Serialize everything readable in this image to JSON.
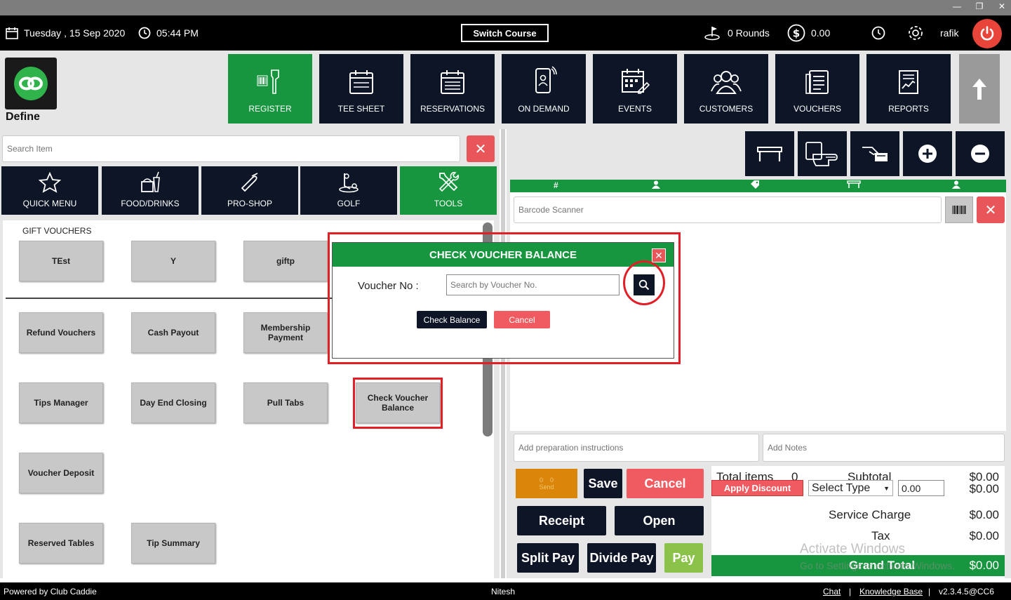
{
  "topbar": {
    "date": "Tuesday ,  15 Sep 2020",
    "time": "05:44 PM",
    "switch_course": "Switch Course",
    "rounds": "0 Rounds",
    "balance": "0.00",
    "user": "rafik"
  },
  "brand": {
    "name": "Define"
  },
  "nav": [
    {
      "label": "REGISTER",
      "icon": "barcode-scanner-icon"
    },
    {
      "label": "TEE SHEET",
      "icon": "calendar-icon"
    },
    {
      "label": "RESERVATIONS",
      "icon": "calendar-list-icon"
    },
    {
      "label": "ON DEMAND",
      "icon": "phone-person-icon"
    },
    {
      "label": "EVENTS",
      "icon": "calendar-edit-icon"
    },
    {
      "label": "CUSTOMERS",
      "icon": "users-icon"
    },
    {
      "label": "VOUCHERS",
      "icon": "voucher-list-icon"
    },
    {
      "label": "REPORTS",
      "icon": "report-icon"
    }
  ],
  "left": {
    "search_placeholder": "Search Item",
    "categories": [
      {
        "label": "QUICK MENU",
        "icon": "star-icon"
      },
      {
        "label": "FOOD/DRINKS",
        "icon": "food-drink-icon"
      },
      {
        "label": "PRO-SHOP",
        "icon": "golf-bag-icon"
      },
      {
        "label": "GOLF",
        "icon": "golf-icon"
      },
      {
        "label": "TOOLS",
        "icon": "tools-icon"
      }
    ],
    "section_label": "GIFT VOUCHERS",
    "gift_vouchers": [
      "TEst",
      "Y",
      "giftp"
    ],
    "tools": [
      "Refund Vouchers",
      "Cash Payout",
      "Membership Payment",
      "Tips Manager",
      "Day End Closing",
      "Pull Tabs",
      "Check Voucher Balance",
      "Voucher Deposit",
      "Reserved Tables",
      "Tip Summary"
    ]
  },
  "right": {
    "barcode_placeholder": "Barcode Scanner",
    "prep_placeholder": "Add preparation instructions",
    "notes_placeholder": "Add Notes",
    "send": {
      "a": "0",
      "b": "0",
      "label": "Send"
    },
    "buttons": {
      "save": "Save",
      "cancel": "Cancel",
      "receipt": "Receipt",
      "open": "Open",
      "split_pay": "Split Pay",
      "divide_pay": "Divide Pay",
      "pay": "Pay"
    },
    "totals": {
      "total_items_label": "Total items",
      "total_items": "0",
      "subtotal_label": "Subtotal",
      "subtotal": "$0.00",
      "apply_discount": "Apply Discount",
      "select_type": "Select Type",
      "discount_value": "0.00",
      "discount": "$0.00",
      "service_label": "Service Charge",
      "service": "$0.00",
      "tax_label": "Tax",
      "tax": "$0.00",
      "grand_label": "Grand Total",
      "grand": "$0.00"
    },
    "watermark": {
      "line1": "Activate Windows",
      "line2": "Go to Settings to activate Windows."
    }
  },
  "modal": {
    "title": "CHECK VOUCHER BALANCE",
    "voucher_label": "Voucher No :",
    "voucher_placeholder": "Search by Voucher No.",
    "check_balance": "Check Balance",
    "cancel": "Cancel"
  },
  "footer": {
    "powered": "Powered by Club Caddie",
    "operator": "Nitesh",
    "chat": "Chat",
    "sep": "|",
    "knowledge": "Knowledge Base",
    "version": "v2.3.4.5@CC6"
  },
  "colors": {
    "green": "#17963f",
    "navy": "#0d1526",
    "red": "#e8565a",
    "highlight": "#e41e26"
  }
}
